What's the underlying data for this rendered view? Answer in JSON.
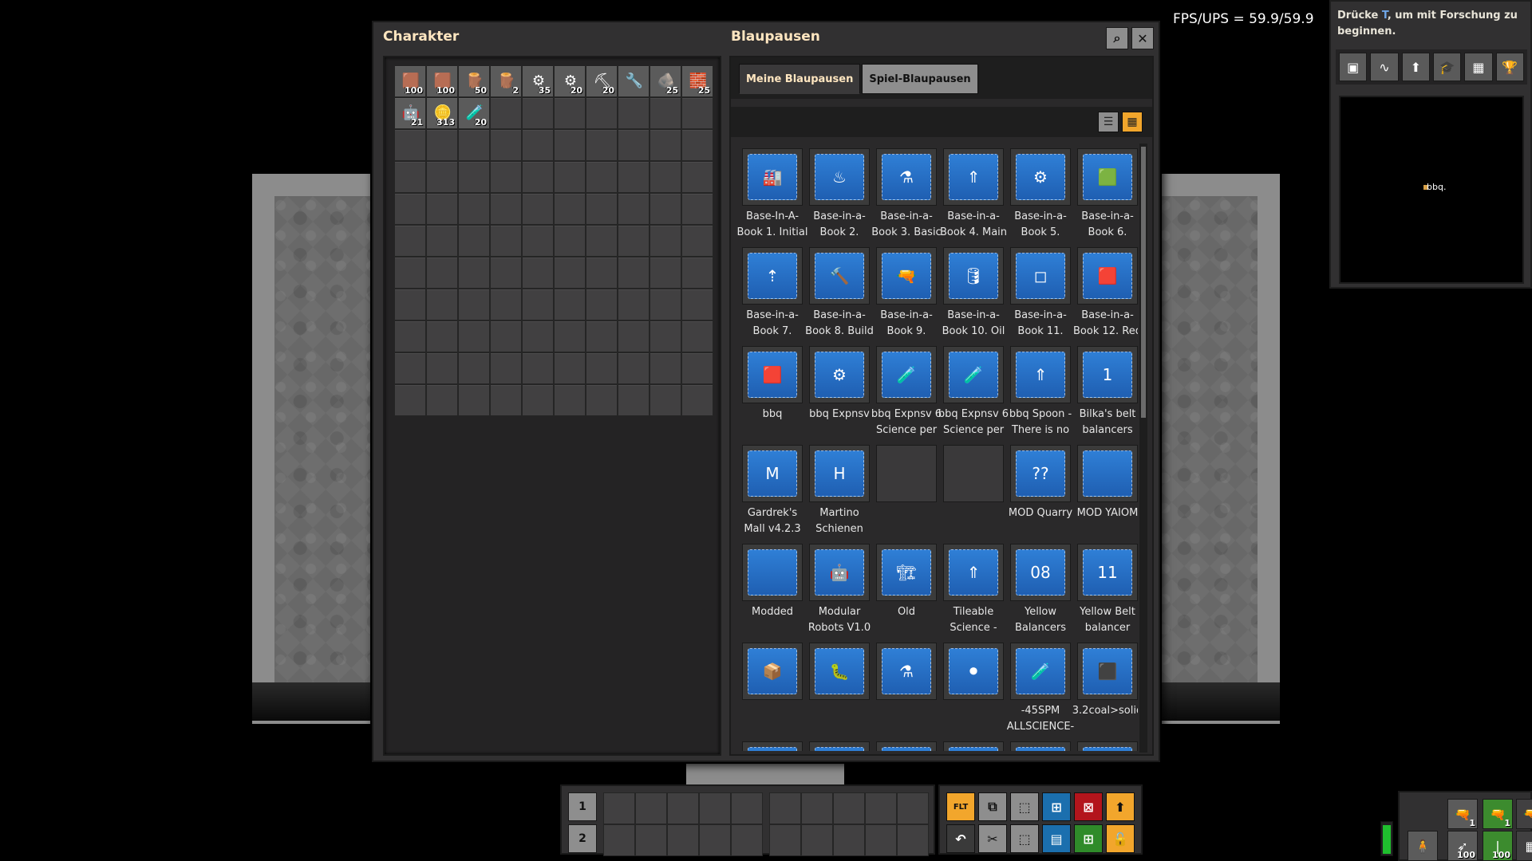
{
  "hud": {
    "fps": "FPS/UPS = 59.9/59.9"
  },
  "research": {
    "hint_prefix": "Drücke ",
    "hint_key": "T",
    "hint_suffix": ", um mit Forschung zu beginnen.",
    "tools": [
      "map-icon",
      "production-icon",
      "rocket-icon",
      "research-icon",
      "factory-icon",
      "achievement-icon"
    ],
    "minimap_label": "bbq."
  },
  "window": {
    "character_title": "Charakter",
    "blueprint_title": "Blaupausen",
    "search_icon": "⌕",
    "close_icon": "✕"
  },
  "inventory": {
    "items": [
      {
        "icon": "🟫",
        "count": "100",
        "name": "belt"
      },
      {
        "icon": "🟫",
        "count": "100",
        "name": "belt-2"
      },
      {
        "icon": "🪵",
        "count": "50",
        "name": "wood"
      },
      {
        "icon": "🪵",
        "count": "2",
        "name": "wood-2"
      },
      {
        "icon": "⚙",
        "count": "35",
        "name": "inserter"
      },
      {
        "icon": "⚙",
        "count": "20",
        "name": "fast-inserter"
      },
      {
        "icon": "⛏",
        "count": "20",
        "name": "pickaxe"
      },
      {
        "icon": "🔧",
        "count": "",
        "name": "tool"
      },
      {
        "icon": "🪨",
        "count": "25",
        "name": "stone"
      },
      {
        "icon": "🧱",
        "count": "25",
        "name": "wall"
      },
      {
        "icon": "🤖",
        "count": "21",
        "name": "robot"
      },
      {
        "icon": "🪙",
        "count": "313",
        "name": "gears"
      },
      {
        "icon": "🧪",
        "count": "20",
        "name": "flask"
      }
    ],
    "total_slots": 110
  },
  "blueprints": {
    "tabs": [
      "Meine Blaupausen",
      "Spiel-Blaupausen"
    ],
    "active_tab": 0,
    "view_list_icon": "☰",
    "view_grid_icon": "▦",
    "items": [
      {
        "label": "Base-In-A-Book 1. Initial",
        "icon": "🏭"
      },
      {
        "label": "Base-in-a-Book 2. Steam",
        "icon": "♨"
      },
      {
        "label": "Base-in-a-Book 3. Basic",
        "icon": "⚗"
      },
      {
        "label": "Base-in-a-Book 4. Main",
        "icon": "⇑"
      },
      {
        "label": "Base-in-a-Book 5.",
        "icon": "⚙"
      },
      {
        "label": "Base-in-a-Book 6. Green",
        "icon": "🟩"
      },
      {
        "label": "Base-in-a-Book 7.",
        "icon": "⇡"
      },
      {
        "label": "Base-in-a-Book 8. Build",
        "icon": "🔨"
      },
      {
        "label": "Base-in-a-Book 9. Military",
        "icon": "🔫"
      },
      {
        "label": "Base-in-a-Book 10. Oil",
        "icon": "🛢"
      },
      {
        "label": "Base-in-a-Book 11. Plastic",
        "icon": "◻"
      },
      {
        "label": "Base-in-a-Book 12. Red",
        "icon": "🟥"
      },
      {
        "label": "bbq",
        "icon": "🟥"
      },
      {
        "label": "bbq Expnsv",
        "icon": "⚙"
      },
      {
        "label": "bbq Expnsv 6 Science per",
        "icon": "🧪"
      },
      {
        "label": "bbq Expnsv 6 Science per",
        "icon": "🧪"
      },
      {
        "label": "bbq Spoon - There is no",
        "icon": "⇑"
      },
      {
        "label": "Bilka's belt balancers",
        "icon": "1"
      },
      {
        "label": "Gardrek's Mall v4.2.3",
        "icon": "M"
      },
      {
        "label": "Martino Schienen",
        "icon": "H"
      },
      {
        "label": "",
        "icon": "",
        "empty": true
      },
      {
        "label": "",
        "icon": "",
        "empty": true
      },
      {
        "label": "MOD Quarry",
        "icon": "??"
      },
      {
        "label": "MOD YAIOM",
        "icon": ""
      },
      {
        "label": "Modded",
        "icon": ""
      },
      {
        "label": "Modular Robots V1.0",
        "icon": "🤖"
      },
      {
        "label": "Old",
        "icon": "🏗"
      },
      {
        "label": "Tileable Science -",
        "icon": "⇑"
      },
      {
        "label": "Yellow Balancers",
        "icon": "08"
      },
      {
        "label": "Yellow Belt balancer",
        "icon": "11"
      },
      {
        "label": "",
        "icon": "📦"
      },
      {
        "label": "",
        "icon": "🐛"
      },
      {
        "label": "",
        "icon": "⚗"
      },
      {
        "label": "",
        "icon": "⚫"
      },
      {
        "label": "-45SPM ALLSCIENCE-",
        "icon": "🧪"
      },
      {
        "label": "3.2coal>solid",
        "icon": "⬛"
      },
      {
        "label": "",
        "icon": "⚙"
      },
      {
        "label": "",
        "icon": ""
      },
      {
        "label": "",
        "icon": "🏗"
      },
      {
        "label": "",
        "icon": "🏗"
      },
      {
        "label": "",
        "icon": "🏗"
      },
      {
        "label": "",
        "icon": "🏗"
      }
    ]
  },
  "quickbar": {
    "row1_label": "1",
    "row2_label": "2"
  },
  "shortcuts": {
    "buttons": [
      {
        "name": "blueprint-filter",
        "glyph": "FLT",
        "color": "#f2a62c"
      },
      {
        "name": "copy",
        "glyph": "⧉",
        "color": "#8e8e8e"
      },
      {
        "name": "select",
        "glyph": "⬚",
        "color": "#8e8e8e"
      },
      {
        "name": "select-blue",
        "glyph": "⊞",
        "color": "#1b6fae"
      },
      {
        "name": "deconstruct",
        "glyph": "⊠",
        "color": "#b3151c"
      },
      {
        "name": "upgrade",
        "glyph": "⬆",
        "color": "#f2a62c"
      },
      {
        "name": "undo",
        "glyph": "↶",
        "color": "#3a3a3a"
      },
      {
        "name": "cut",
        "glyph": "✂",
        "color": "#8e8e8e"
      },
      {
        "name": "paste",
        "glyph": "⬚",
        "color": "#8e8e8e"
      },
      {
        "name": "blueprint-book",
        "glyph": "▤",
        "color": "#1b6fae"
      },
      {
        "name": "green-select",
        "glyph": "⊞",
        "color": "#2f8b2a"
      },
      {
        "name": "unlock",
        "glyph": "🔓",
        "color": "#f2a62c"
      }
    ]
  },
  "weapons": {
    "slots": [
      {
        "glyph": "🔫",
        "count": "1",
        "style": "normal"
      },
      {
        "glyph": "🔫",
        "count": "1",
        "style": "green"
      },
      {
        "glyph": "🔫",
        "count": "",
        "style": "dark"
      },
      {
        "glyph": "🧍",
        "count": "",
        "style": "normal"
      },
      {
        "glyph": "➶",
        "count": "100",
        "style": "normal"
      },
      {
        "glyph": "❘",
        "count": "100",
        "style": "green"
      },
      {
        "glyph": "▦",
        "count": "",
        "style": "dark"
      }
    ]
  }
}
